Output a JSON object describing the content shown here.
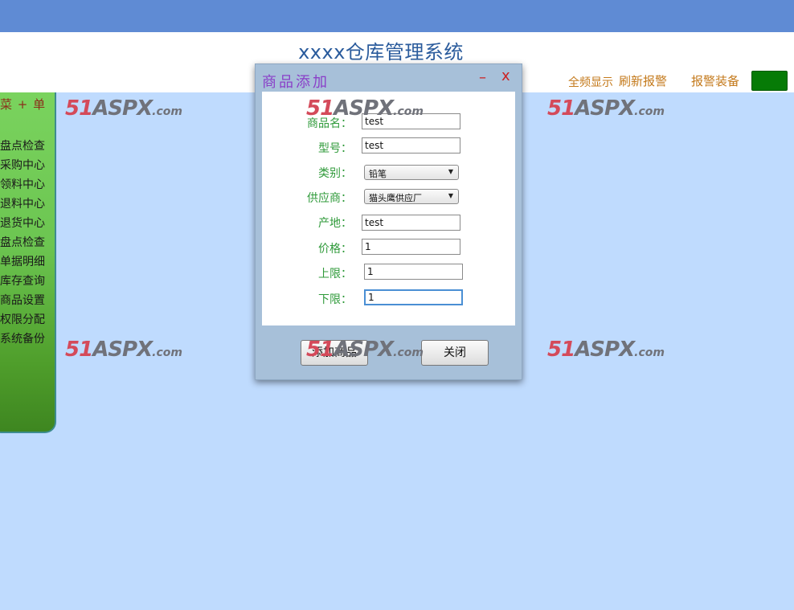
{
  "header": {
    "title": "xxxx仓库管理系统",
    "links": [
      "全频显示",
      "刷新报警",
      "报警装备"
    ]
  },
  "sidebar": {
    "heading": "菜 + 单",
    "items": [
      "盘点检查",
      "采购中心",
      "领料中心",
      "退料中心",
      "退货中心",
      "盘点检查",
      "单据明细",
      "库存查询",
      "商品设置",
      "权限分配",
      "系统备份"
    ]
  },
  "watermark": {
    "num": "51",
    "asp": "ASPX",
    "com": ".com"
  },
  "dialog": {
    "title": "商品添加",
    "min_label": "–",
    "close_label": "x",
    "fields": {
      "name": {
        "label": "商品名：",
        "value": "test"
      },
      "model": {
        "label": "型号：",
        "value": "test"
      },
      "category": {
        "label": "类别：",
        "value": "铅笔"
      },
      "supplier": {
        "label": "供应商：",
        "value": "猫头鹰供应厂"
      },
      "origin": {
        "label": "产地：",
        "value": "test"
      },
      "price": {
        "label": "价格：",
        "value": "1"
      },
      "upper": {
        "label": "上限：",
        "value": "1"
      },
      "lower": {
        "label": "下限：",
        "value": "1"
      }
    },
    "buttons": {
      "add": "添加商品",
      "close": "关闭"
    }
  }
}
